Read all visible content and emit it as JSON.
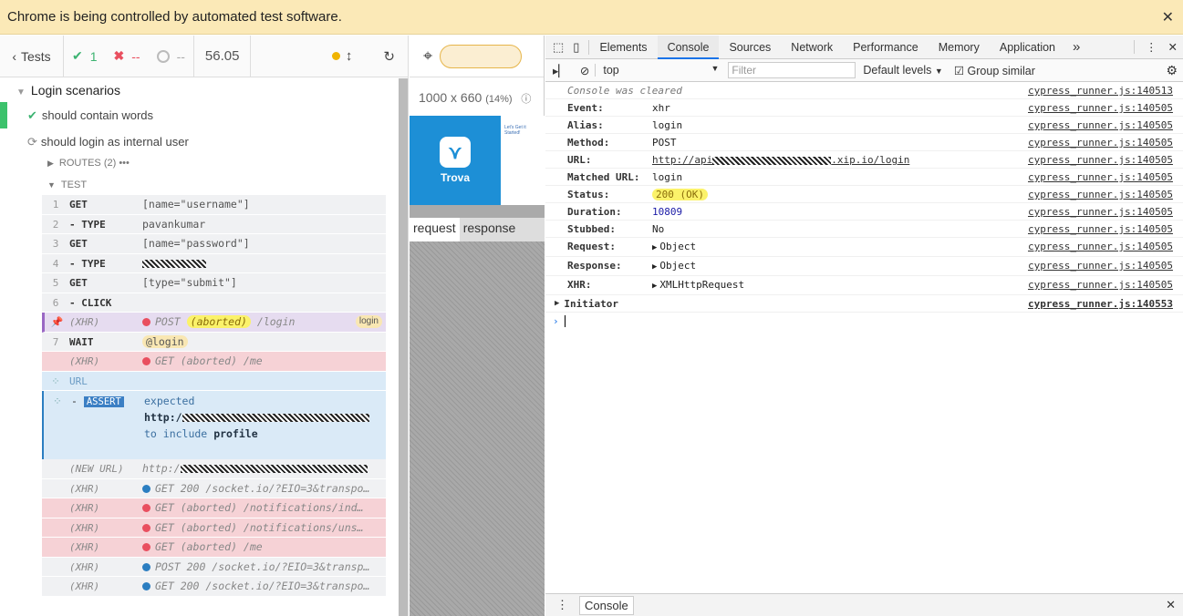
{
  "infobar": {
    "message": "Chrome is being controlled by automated test software.",
    "close": "✕"
  },
  "reporter": {
    "tests_label": "Tests",
    "passed": "1",
    "failed": "--",
    "pending": "--",
    "duration": "56.05",
    "suite": "Login scenarios",
    "test1": "should contain words",
    "test2": "should login as internal user",
    "routes": "ROUTES (2)",
    "routes_more": "•••",
    "test_label": "TEST",
    "commands": [
      {
        "n": "1",
        "name": "GET",
        "msg": "[name=\"username\"]"
      },
      {
        "n": "2",
        "name": "- TYPE",
        "msg": "pavankumar"
      },
      {
        "n": "3",
        "name": "GET",
        "msg": "[name=\"password\"]"
      },
      {
        "n": "4",
        "name": "- TYPE",
        "msg": ""
      },
      {
        "n": "5",
        "name": "GET",
        "msg": "[type=\"submit\"]"
      },
      {
        "n": "6",
        "name": "- CLICK",
        "msg": ""
      }
    ],
    "xhr_login": {
      "name": "(XHR)",
      "method": "POST",
      "aborted": "(aborted)",
      "path": "/login",
      "alias": "login"
    },
    "wait": {
      "n": "7",
      "name": "WAIT",
      "alias": "@login"
    },
    "xhr_me": {
      "name": "(XHR)",
      "text": "GET (aborted) /me"
    },
    "url_label": "URL",
    "assert": {
      "badge": "ASSERT",
      "expected": "expected",
      "url": "http:/",
      "include": "to include",
      "value": "profile"
    },
    "new_url": {
      "name": "(NEW URL)",
      "text": "http:/"
    },
    "rows": [
      {
        "name": "(XHR)",
        "text": "GET 200 /socket.io/?EIO=3&transpo…",
        "kind": "blue"
      },
      {
        "name": "(XHR)",
        "text": "GET (aborted) /notifications/ind…",
        "kind": "red"
      },
      {
        "name": "(XHR)",
        "text": "GET (aborted) /notifications/uns…",
        "kind": "red"
      },
      {
        "name": "(XHR)",
        "text": "GET (aborted) /me",
        "kind": "red"
      },
      {
        "name": "(XHR)",
        "text": "POST 200 /socket.io/?EIO=3&transp…",
        "kind": "blue"
      },
      {
        "name": "(XHR)",
        "text": "GET 200 /socket.io/?EIO=3&transpo…",
        "kind": "blue"
      }
    ]
  },
  "aut": {
    "viewport": "1000 x 660",
    "scale": "(14%)",
    "brand": "Trova",
    "preview_heading": "Let's Get it Started!",
    "tab_request": "request",
    "tab_response": "response"
  },
  "devtools": {
    "tabs": [
      "Elements",
      "Console",
      "Sources",
      "Network",
      "Performance",
      "Memory",
      "Application"
    ],
    "more": "»",
    "context": "top",
    "filter_placeholder": "Filter",
    "levels": "Default levels",
    "group": "Group similar",
    "cleared": "Console was cleared",
    "cleared_src": "cypress_runner.js:140513",
    "lines": [
      {
        "k": "Event:",
        "v": "xhr",
        "src": "cypress_runner.js:140505"
      },
      {
        "k": "Alias:",
        "v": "login",
        "src": "cypress_runner.js:140505"
      },
      {
        "k": "Method:",
        "v": "POST",
        "src": "cypress_runner.js:140505"
      },
      {
        "k": "URL:",
        "v": "http://api",
        "v2": ".xip.io/login",
        "src": "cypress_runner.js:140505"
      },
      {
        "k": "Matched URL:",
        "v": "login",
        "src": "cypress_runner.js:140505"
      },
      {
        "k": "Status:",
        "v": "200 (OK)",
        "src": "cypress_runner.js:140505"
      },
      {
        "k": "Duration:",
        "v": "10809",
        "src": "cypress_runner.js:140505"
      },
      {
        "k": "Stubbed:",
        "v": "No",
        "src": "cypress_runner.js:140505"
      },
      {
        "k": "Request:",
        "v": "Object",
        "src": "cypress_runner.js:140505"
      },
      {
        "k": "Response:",
        "v": "Object",
        "src": "cypress_runner.js:140505"
      },
      {
        "k": "XHR:",
        "v": "XMLHttpRequest",
        "src": "cypress_runner.js:140505"
      }
    ],
    "initiator": "Initiator",
    "initiator_src": "cypress_runner.js:140553",
    "drawer_tab": "Console"
  }
}
